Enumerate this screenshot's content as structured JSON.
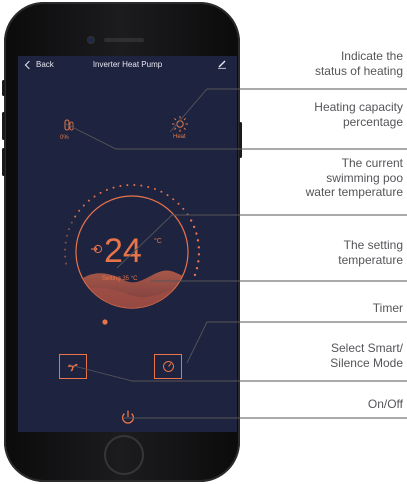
{
  "screen": {
    "back_label": "Back",
    "title": "Inverter Heat Pump",
    "capacity_value": "0%",
    "status_label": "Heat",
    "current_temp": "24",
    "temp_unit": "°C",
    "setting_label": "Setting 35 °C"
  },
  "annotations": [
    {
      "key": "heating-status",
      "lines": [
        "Indicate the",
        "status of heating"
      ]
    },
    {
      "key": "heating-capacity",
      "lines": [
        "Heating capacity",
        "percentage"
      ]
    },
    {
      "key": "current-water-temp",
      "lines": [
        "The current",
        "swimming poo",
        "water temperature"
      ]
    },
    {
      "key": "setting-temp",
      "lines": [
        "The setting",
        "temperature"
      ]
    },
    {
      "key": "timer",
      "lines": [
        "Timer"
      ]
    },
    {
      "key": "smart-silence-mode",
      "lines": [
        "Select Smart/",
        "Silence Mode"
      ]
    },
    {
      "key": "on-off",
      "lines": [
        "On/Off"
      ]
    }
  ],
  "colors": {
    "accent": "#e8744a",
    "screen_bg": "#1e2340",
    "phone_body": "#111113",
    "leader_line": "#555559"
  },
  "icons": [
    "back-chevron-icon",
    "edit-pencil-icon",
    "capacity-gauge-icon",
    "sun-heat-icon",
    "water-inlet-icon",
    "fan-icon",
    "timer-icon",
    "power-icon"
  ]
}
